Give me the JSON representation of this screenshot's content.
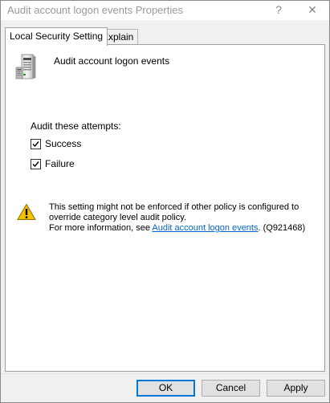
{
  "window": {
    "title": "Audit account logon events Properties",
    "help_glyph": "?",
    "close_glyph": "✕"
  },
  "tabs": [
    {
      "label": "Local Security Setting",
      "active": true
    },
    {
      "label": "Explain",
      "active": false
    }
  ],
  "panel": {
    "policy_name": "Audit account logon events",
    "audit_label": "Audit these attempts:",
    "checkboxes": [
      {
        "label": "Success",
        "checked": true
      },
      {
        "label": "Failure",
        "checked": true
      }
    ],
    "warning": {
      "line1": "This setting might not be enforced if other policy is configured to",
      "line2": "override category level audit policy.",
      "line3_prefix": "For more information, see ",
      "link_text": "Audit account logon events",
      "line3_suffix": ". (Q921468)"
    }
  },
  "buttons": {
    "ok": "OK",
    "cancel": "Cancel",
    "apply": "Apply"
  },
  "colors": {
    "link": "#0066cc",
    "default_button_border": "#0078d7",
    "warning_yellow": "#f2c200"
  },
  "icons": {
    "policy": "server-icon",
    "warning": "warning-icon",
    "check": "checkmark-icon"
  }
}
